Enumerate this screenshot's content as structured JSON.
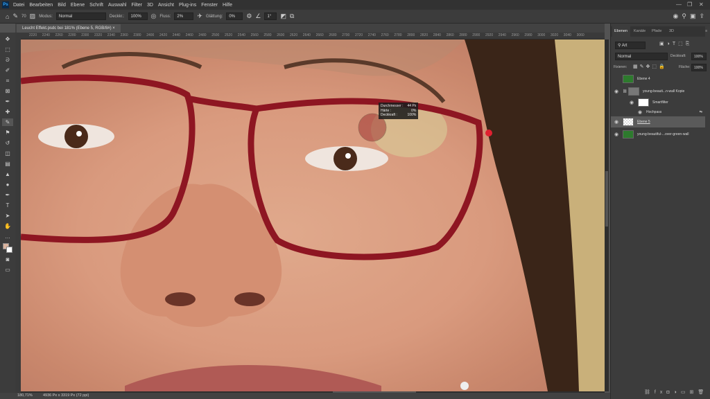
{
  "app": {
    "logo": "Ps"
  },
  "menu": [
    "Datei",
    "Bearbeiten",
    "Bild",
    "Ebene",
    "Schrift",
    "Auswahl",
    "Filter",
    "3D",
    "Ansicht",
    "Plug-ins",
    "Fenster",
    "Hilfe"
  ],
  "options": {
    "brush_size": "70",
    "modus_label": "Modus:",
    "modus_value": "Normal",
    "deckkraft_label": "Deckkr.:",
    "deckkraft_value": "100%",
    "fluss_label": "Fluss:",
    "fluss_value": "2%",
    "glaettung_label": "Glättung:",
    "glaettung_value": "0%",
    "angle_value": "1°"
  },
  "document": {
    "tab_title": "Leucht Effekt.psdc bei 181% (Ebene 5, RGB/8#)"
  },
  "ruler": {
    "ticks": [
      "2220",
      "2240",
      "2260",
      "2280",
      "2300",
      "2320",
      "2340",
      "2360",
      "2380",
      "2400",
      "2420",
      "2440",
      "2460",
      "2480",
      "2500",
      "2520",
      "2540",
      "2560",
      "2580",
      "2600",
      "2620",
      "2640",
      "2660",
      "2680",
      "2700",
      "2720",
      "2740",
      "2760",
      "2780",
      "2800",
      "2820",
      "2840",
      "2860",
      "2880",
      "2900",
      "2920",
      "2940",
      "2960",
      "2980",
      "3000",
      "3020",
      "3040",
      "3060"
    ]
  },
  "brush_tooltip": {
    "rows": [
      {
        "label": "Durchmesser :",
        "value": "44 Px"
      },
      {
        "label": "Härte :",
        "value": "0%"
      },
      {
        "label": "Deckkraft :",
        "value": "100%"
      }
    ]
  },
  "status": {
    "zoom": "180,71%",
    "doc_size": "4936 Px x 3319 Px (72 ppi)"
  },
  "layers_panel": {
    "tabs": [
      "Ebenen",
      "Kanäle",
      "Pfade",
      "3D"
    ],
    "filter_kind": "Art",
    "blend_mode": "Normal",
    "opacity_label": "Deckkraft:",
    "opacity_value": "100%",
    "lock_label": "Fixieren:",
    "fill_label": "Fläche:",
    "fill_value": "100%",
    "layers": [
      {
        "name": "Ebene 4",
        "visible": false
      },
      {
        "name": "young-beauti...n-wall Kopie",
        "visible": true
      },
      {
        "name": "Smartfilter",
        "visible": true
      },
      {
        "name": "Hochpass",
        "visible": true
      },
      {
        "name": "Ebene 5",
        "visible": true,
        "selected": true
      },
      {
        "name": "young-beautiful-...over-green-wall",
        "visible": true
      }
    ]
  },
  "colors": {
    "accent": "#31a8ff",
    "glasses": "#8e1622"
  }
}
